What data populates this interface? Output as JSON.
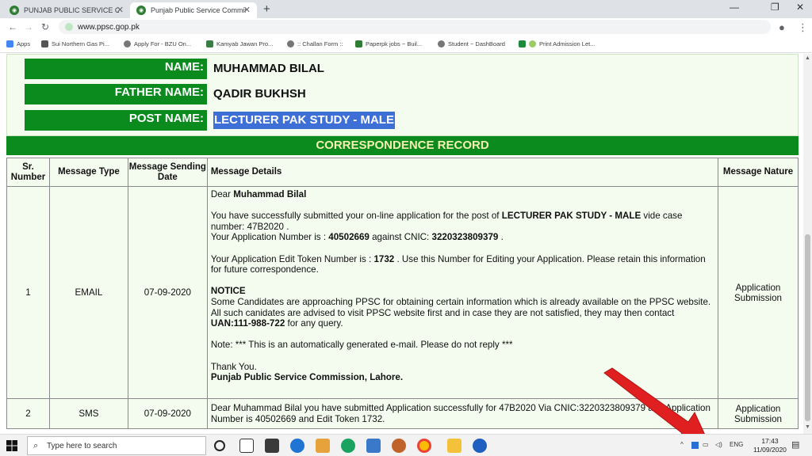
{
  "browser": {
    "tabs": [
      {
        "title": "PUNJAB PUBLIC SERVICE COMMI",
        "active": false
      },
      {
        "title": "Punjab Public Service Commissio",
        "active": true
      }
    ],
    "new_tab": "+",
    "window_controls": {
      "minimize": "—",
      "maximize": "❐",
      "close": "✕"
    },
    "address": "www.ppsc.gop.pk",
    "bookmarks": [
      {
        "label": "Apps",
        "color": "#4285f4"
      },
      {
        "label": "Sui Northern Gas Pi...",
        "color": "#555555"
      },
      {
        "label": "Apply For - BZU On...",
        "color": "#777777"
      },
      {
        "label": "Kamyab Jawan Pro...",
        "color": "#3a7d44"
      },
      {
        "label": ":: Challan Form ::",
        "color": "#777777"
      },
      {
        "label": "Paperpk jobs ~ Buil...",
        "color": "#2e7d32"
      },
      {
        "label": "Student ~ DashBoard",
        "color": "#777777"
      },
      {
        "label": "Print Admission Let...",
        "color": "#1b8a3a"
      }
    ]
  },
  "candidate": {
    "name_label": "NAME:",
    "name": "MUHAMMAD BILAL",
    "father_label": "FATHER NAME:",
    "father": "QADIR BUKHSH",
    "post_label": "POST NAME:",
    "post": "LECTURER PAK STUDY - MALE"
  },
  "record_title": "CORRESPONDENCE RECORD",
  "table": {
    "headers": {
      "sr": "Sr. Number",
      "type": "Message Type",
      "date": "Message Sending Date",
      "details": "Message Details",
      "nature": "Message Nature"
    },
    "rows": [
      {
        "sr": "1",
        "type": "EMAIL",
        "date": "07-09-2020",
        "nature": "Application Submission",
        "greeting": "Dear",
        "greeting_name": "Muhammad Bilal",
        "p1a": "You have successfully submitted your on-line application for the post of",
        "p1post": "LECTURER PAK STUDY - MALE",
        "p1b": "vide case number: 47B2020 .",
        "p2a": "Your Application Number is :",
        "p2num": "40502669",
        "p2b": "against CNIC:",
        "p2cnic": "3220323809379",
        "p2c": ".",
        "p3a": "Your Application Edit Token Number is :",
        "p3token": "1732",
        "p3b": ". Use this Number for Editing your Application. Please retain this information for future correspondence.",
        "notice_title": "NOTICE",
        "notice1": "Some Candidates are approaching PPSC for obtaining certain information which is already available on the PPSC website.",
        "notice2": "All such canidates are advised to visit PPSC website first and in case they are not satisfied, they may then contact",
        "uan": "UAN:111-988-722",
        "notice3": "for any query.",
        "note": "Note: *** This is an automatically generated e-mail. Please do not reply ***",
        "thanks": "Thank You.",
        "signoff": "Punjab Public Service Commission, Lahore."
      },
      {
        "sr": "2",
        "type": "SMS",
        "date": "07-09-2020",
        "nature": "Application Submission",
        "details": "Dear Muhammad Bilal you have submitted Application successfully for 47B2020 Via CNIC:3220323809379 and Application Number is 40502669 and Edit Token 1732."
      }
    ]
  },
  "taskbar": {
    "search_placeholder": "Type here to search",
    "lang": "ENG",
    "time": "17:43",
    "date": "11/09/2020"
  },
  "colors": {
    "ppsc_green": "#0b8a1e",
    "panel_bg": "#f4fbef",
    "selection": "#3d6fd6",
    "arrow_red": "#e02020"
  }
}
